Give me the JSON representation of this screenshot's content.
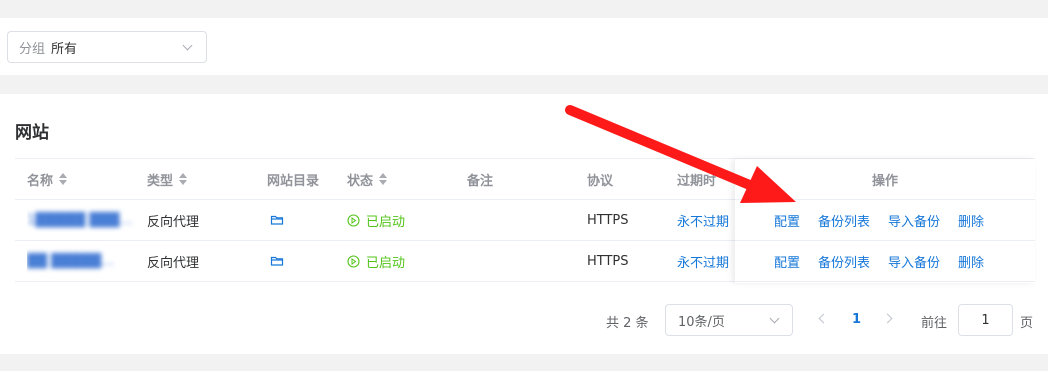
{
  "filter": {
    "prefix": "分组",
    "value": "所有"
  },
  "card_title": "网站",
  "table": {
    "headers": {
      "name": "名称",
      "type": "类型",
      "dir": "网站目录",
      "status": "状态",
      "note": "备注",
      "protocol": "协议",
      "expire": "过期时",
      "ops": "操作"
    },
    "rows": [
      {
        "name": "1█████ ███…",
        "type": "反向代理",
        "dir_icon": "folder-icon",
        "status": "已启动",
        "note": "",
        "protocol": "HTTPS",
        "expire": "永不过期",
        "ops": [
          "配置",
          "备份列表",
          "导入备份",
          "删除"
        ]
      },
      {
        "name": "██ █████…",
        "type": "反向代理",
        "dir_icon": "folder-icon",
        "status": "已启动",
        "note": "",
        "protocol": "HTTPS",
        "expire": "永不过期",
        "ops": [
          "配置",
          "备份列表",
          "导入备份",
          "删除"
        ]
      }
    ]
  },
  "pagination": {
    "total": "共 2 条",
    "page_size": "10条/页",
    "current_page": "1",
    "goto_label": "前往",
    "goto_value": "1",
    "page_unit": "页"
  },
  "colors": {
    "link": "#1677d9",
    "running": "#52c41a",
    "annotation_arrow": "#ff1a1a"
  }
}
